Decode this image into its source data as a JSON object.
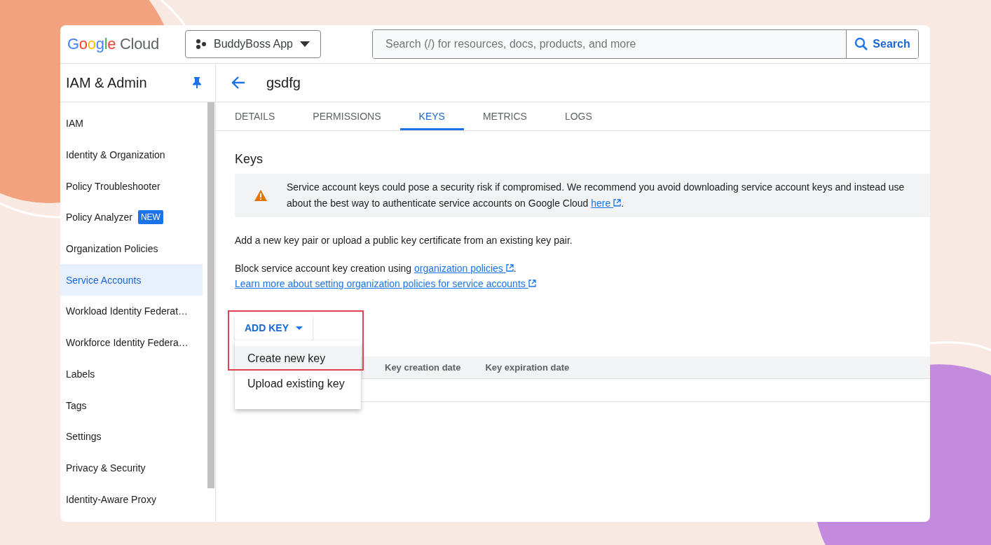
{
  "header": {
    "logo": {
      "brand": "Google",
      "product": "Cloud"
    },
    "project": "BuddyBoss App",
    "search": {
      "placeholder": "Search (/) for resources, docs, products, and more",
      "button": "Search"
    }
  },
  "sidebar": {
    "title": "IAM & Admin",
    "items": [
      {
        "label": "IAM",
        "selected": false
      },
      {
        "label": "Identity & Organization",
        "selected": false
      },
      {
        "label": "Policy Troubleshooter",
        "selected": false
      },
      {
        "label": "Policy Analyzer",
        "selected": false,
        "badge": "NEW"
      },
      {
        "label": "Organization Policies",
        "selected": false
      },
      {
        "label": "Service Accounts",
        "selected": true
      },
      {
        "label": "Workload Identity Federat…",
        "selected": false
      },
      {
        "label": "Workforce Identity Federa…",
        "selected": false
      },
      {
        "label": "Labels",
        "selected": false
      },
      {
        "label": "Tags",
        "selected": false
      },
      {
        "label": "Settings",
        "selected": false
      },
      {
        "label": "Privacy & Security",
        "selected": false
      },
      {
        "label": "Identity-Aware Proxy",
        "selected": false
      }
    ]
  },
  "page": {
    "title": "gsdfg",
    "tabs": [
      {
        "label": "DETAILS",
        "selected": false
      },
      {
        "label": "PERMISSIONS",
        "selected": false
      },
      {
        "label": "KEYS",
        "selected": true
      },
      {
        "label": "METRICS",
        "selected": false
      },
      {
        "label": "LOGS",
        "selected": false
      }
    ],
    "section_title": "Keys",
    "warning": {
      "line_1": "Service account keys could pose a security risk if compromised. We recommend you avoid downloading service account keys and instead use",
      "line_2": "about the best way to authenticate service accounts on Google Cloud",
      "link": "here",
      "end": "."
    },
    "intro": "Add a new key pair or upload a public key certificate from an existing key pair.",
    "block_text": "Block service account key creation using",
    "block_link": "organization policies",
    "block_end": ".",
    "learn_link": "Learn more about setting organization policies for service accounts",
    "add_key_button": "ADD KEY",
    "menu": [
      {
        "label": "Create new key",
        "selected": true
      },
      {
        "label": "Upload existing key",
        "selected": false
      }
    ],
    "table": {
      "columns": [
        "Key creation date",
        "Key expiration date"
      ]
    }
  }
}
